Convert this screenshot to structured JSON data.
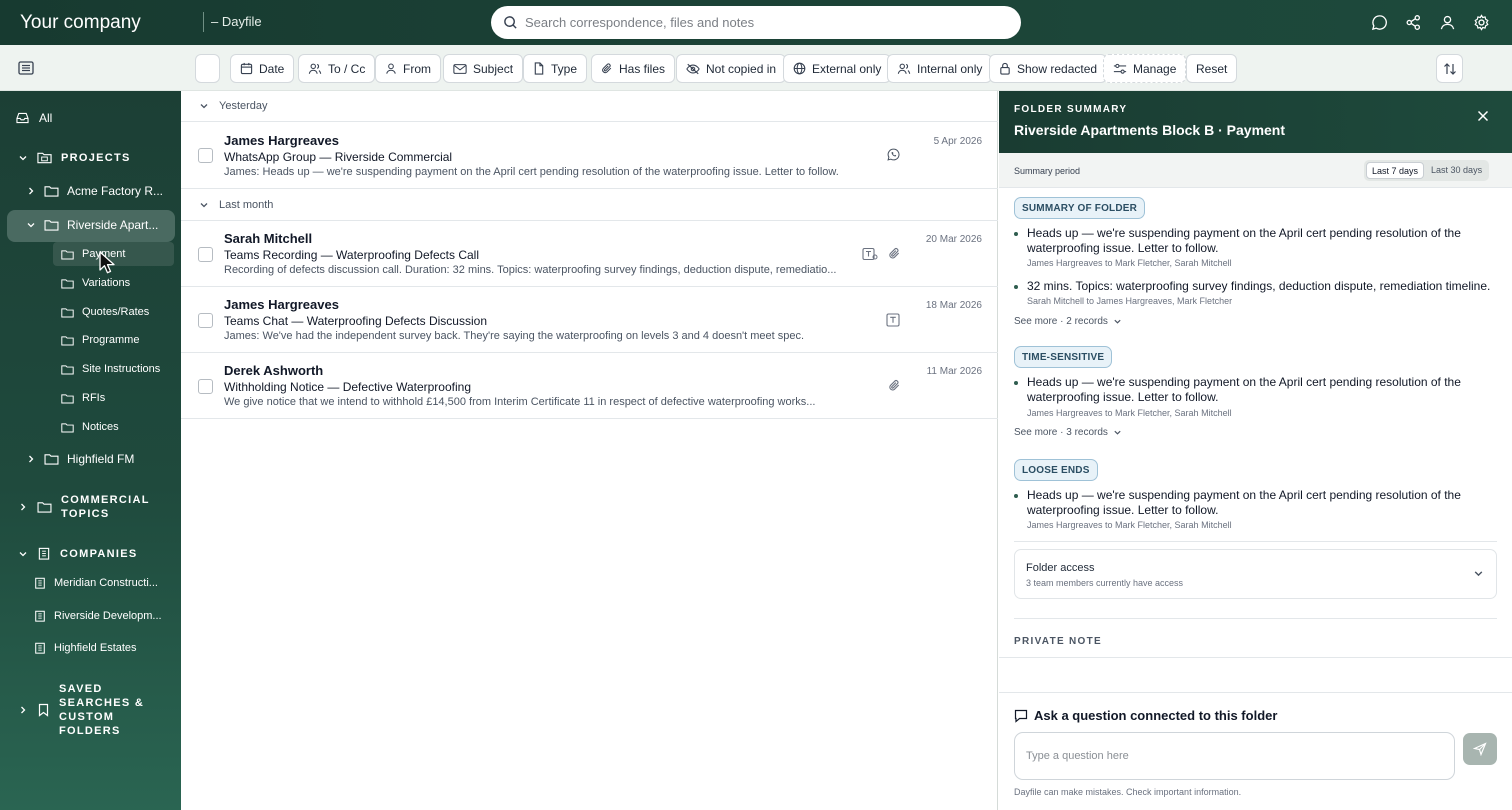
{
  "topbar": {
    "brand": "Your company",
    "product": "– Dayfile",
    "search_placeholder": "Search correspondence, files and notes",
    "icons": [
      "chat-icon",
      "share-icon",
      "user-icon",
      "settings-icon"
    ]
  },
  "toolbar": {
    "filters": [
      {
        "label": "",
        "icon": "blank"
      },
      {
        "label": "Date",
        "icon": "calendar-icon"
      },
      {
        "label": "To / Cc",
        "icon": "users-icon"
      },
      {
        "label": "From",
        "icon": "user-icon"
      },
      {
        "label": "Subject",
        "icon": "mail-icon"
      },
      {
        "label": "Type",
        "icon": "file-type-icon"
      },
      {
        "label": "Has files",
        "icon": "paperclip-icon"
      },
      {
        "label": "Not copied in",
        "icon": "eye-off-icon"
      },
      {
        "label": "External only",
        "icon": "globe-icon"
      },
      {
        "label": "Internal only",
        "icon": "users-icon"
      },
      {
        "label": "Show redacted",
        "icon": "lock-icon"
      },
      {
        "label": "Manage",
        "icon": "sliders-icon"
      },
      {
        "label": "Reset",
        "icon": ""
      }
    ]
  },
  "sidebar": {
    "all": "All",
    "projects_label": "PROJECTS",
    "projects": [
      "Acme Factory R...",
      "Riverside Apart...",
      "Highfield FM"
    ],
    "folders": [
      "Payment",
      "Variations",
      "Quotes/Rates",
      "Programme",
      "Site Instructions",
      "RFIs",
      "Notices"
    ],
    "commercial_topics": "COMMERCIAL TOPICS",
    "companies_label": "COMPANIES",
    "companies": [
      "Meridian Constructi...",
      "Riverside Developm...",
      "Highfield Estates"
    ],
    "saved_searches": "SAVED SEARCHES & CUSTOM FOLDERS"
  },
  "list": {
    "groups": [
      "Yesterday",
      "Last month"
    ],
    "items": [
      {
        "sender": "James Hargreaves",
        "subject": "WhatsApp Group — Riverside Commercial",
        "preview": "James: Heads up — we're suspending payment on the April cert pending resolution of the waterproofing issue. Letter to follow.",
        "date": "5 Apr 2026"
      },
      {
        "sender": "Sarah Mitchell",
        "subject": "Teams Recording — Waterproofing Defects Call",
        "preview": "Recording of defects discussion call. Duration: 32 mins. Topics: waterproofing survey findings, deduction dispute, remediatio...",
        "date": "20 Mar 2026"
      },
      {
        "sender": "James Hargreaves",
        "subject": "Teams Chat — Waterproofing Defects Discussion",
        "preview": "James: We've had the independent survey back. They're saying the waterproofing on levels 3 and 4 doesn't meet spec.",
        "date": "18 Mar 2026"
      },
      {
        "sender": "Derek Ashworth",
        "subject": "Withholding Notice — Defective Waterproofing",
        "preview": "We give notice that we intend to withhold £14,500 from Interim Certificate 11 in respect of defective waterproofing works...",
        "date": "11 Mar 2026"
      }
    ]
  },
  "panel": {
    "caption": "FOLDER SUMMARY",
    "title": "Riverside Apartments Block B · Payment",
    "period_label": "Summary period",
    "period_options": [
      "Last 7 days",
      "Last 30 days"
    ],
    "sections": [
      {
        "tag": "SUMMARY OF FOLDER",
        "items": [
          {
            "text": "Heads up — we're suspending payment on the April cert pending resolution of the waterproofing issue. Letter to follow.",
            "meta": "James Hargreaves to Mark Fletcher, Sarah Mitchell"
          },
          {
            "text": "32 mins. Topics: waterproofing survey findings, deduction dispute, remediation timeline.",
            "meta": "Sarah Mitchell to James Hargreaves, Mark Fletcher"
          }
        ],
        "see_more": "See more · 2 records"
      },
      {
        "tag": "TIME-SENSITIVE",
        "items": [
          {
            "text": "Heads up — we're suspending payment on the April cert pending resolution of the waterproofing issue. Letter to follow.",
            "meta": "James Hargreaves to Mark Fletcher, Sarah Mitchell"
          }
        ],
        "see_more": "See more · 3 records"
      },
      {
        "tag": "LOOSE ENDS",
        "items": [
          {
            "text": "Heads up — we're suspending payment on the April cert pending resolution of the waterproofing issue. Letter to follow.",
            "meta": "James Hargreaves to Mark Fletcher, Sarah Mitchell"
          }
        ]
      }
    ],
    "access_title": "Folder access",
    "access_sub": "3 team members currently have access",
    "private_note": "PRIVATE NOTE",
    "ask_title": "Ask a question connected to this folder",
    "ask_placeholder": "Type a question here",
    "disclaimer": "Dayfile can make mistakes. Check important information."
  }
}
